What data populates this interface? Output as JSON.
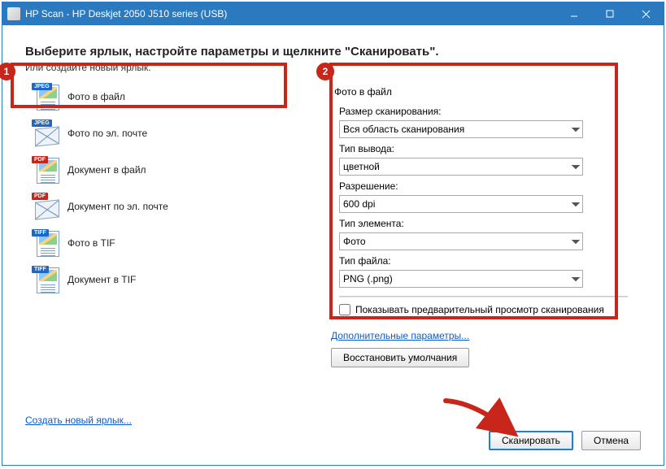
{
  "window_title": "HP Scan - HP Deskjet 2050 J510 series (USB)",
  "heading": "Выберите ярлык, настройте параметры и щелкните \"Сканировать\".",
  "subheading": "Или создайте новый ярлык.",
  "shortcuts": [
    {
      "label": "Фото в файл",
      "badge": "JPEG",
      "badge_class": "jpeg",
      "icon": "page"
    },
    {
      "label": "Фото по эл. почте",
      "badge": "JPEG",
      "badge_class": "jpeg",
      "icon": "env"
    },
    {
      "label": "Документ в файл",
      "badge": "PDF",
      "badge_class": "pdf",
      "icon": "page"
    },
    {
      "label": "Документ по эл. почте",
      "badge": "PDF",
      "badge_class": "pdf",
      "icon": "env"
    },
    {
      "label": "Фото в TIF",
      "badge": "TIFF",
      "badge_class": "tiff",
      "icon": "page"
    },
    {
      "label": "Документ в TIF",
      "badge": "TIFF",
      "badge_class": "tiff",
      "icon": "page"
    }
  ],
  "panel_title": "Фото в файл",
  "fields": {
    "scan_size_label": "Размер сканирования:",
    "scan_size_value": "Вся область сканирования",
    "output_type_label": "Тип вывода:",
    "output_type_value": "цветной",
    "resolution_label": "Разрешение:",
    "resolution_value": "600 dpi",
    "item_type_label": "Тип элемента:",
    "item_type_value": "Фото",
    "file_type_label": "Тип файла:",
    "file_type_value": "PNG (.png)"
  },
  "preview_checkbox": "Показывать предварительный просмотр сканирования",
  "extra_params_link": "Дополнительные параметры...",
  "restore_defaults": "Восстановить умолчания",
  "create_shortcut_link": "Создать новый ярлык...",
  "scan_button": "Сканировать",
  "cancel_button": "Отмена",
  "annotations": {
    "one": "1",
    "two": "2"
  }
}
